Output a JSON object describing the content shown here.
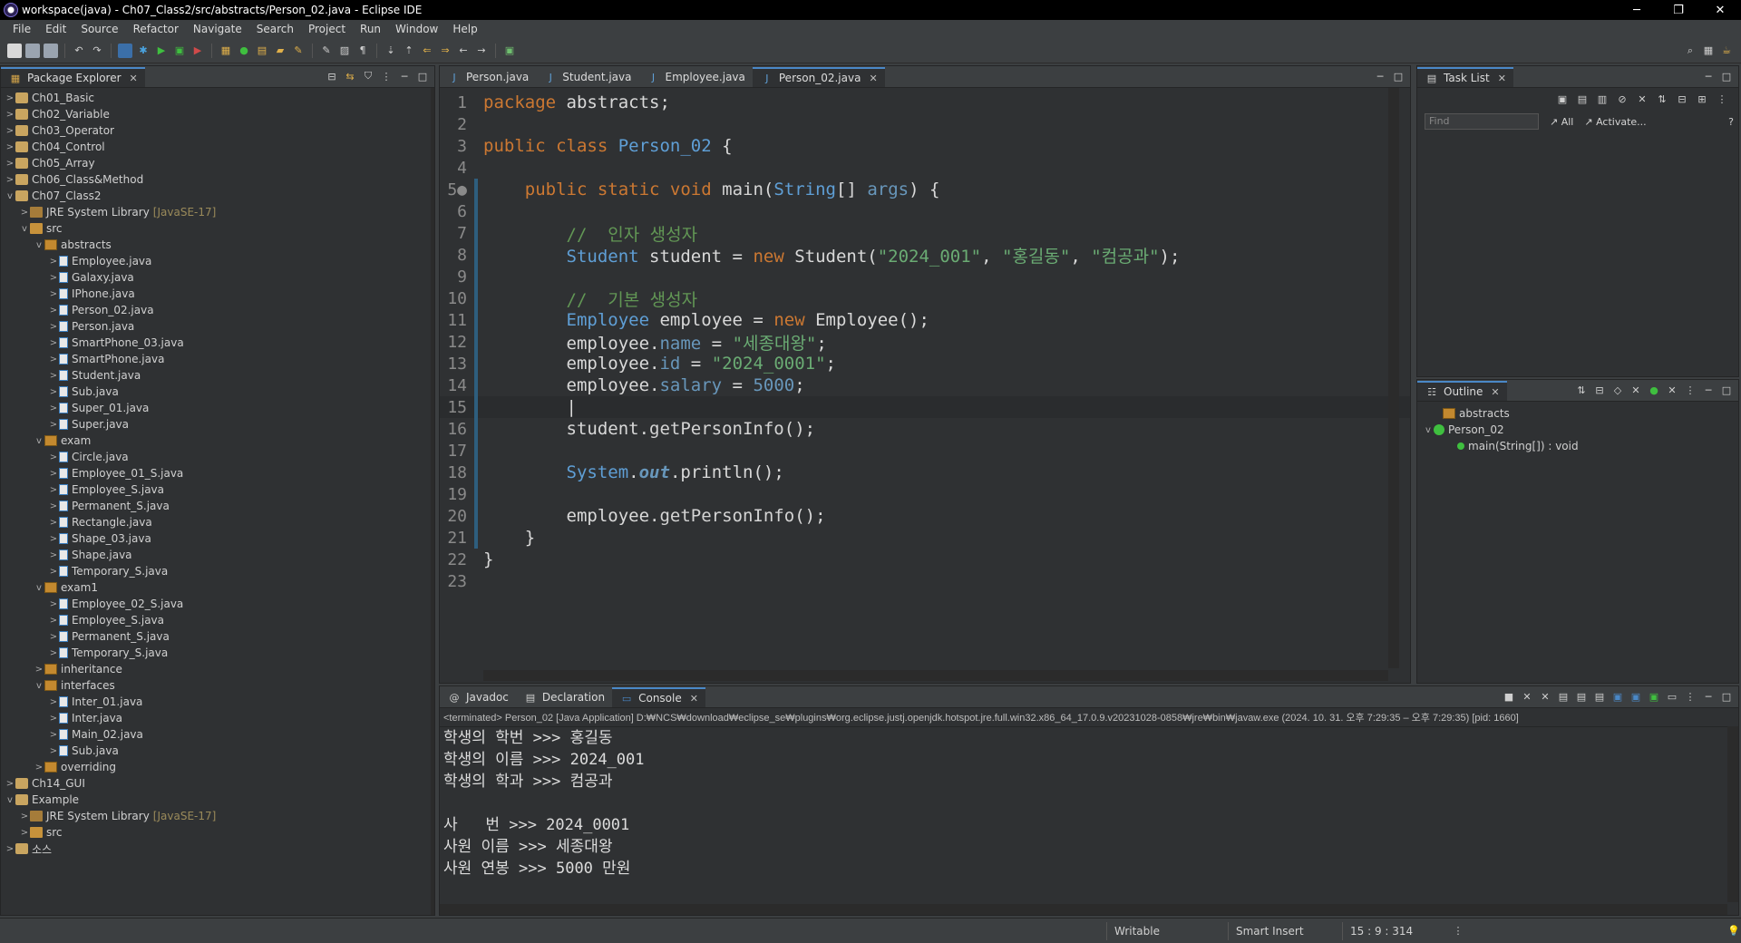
{
  "window": {
    "title": "workspace(java) - Ch07_Class2/src/abstracts/Person_02.java - Eclipse IDE"
  },
  "menu": [
    "File",
    "Edit",
    "Source",
    "Refactor",
    "Navigate",
    "Search",
    "Project",
    "Run",
    "Window",
    "Help"
  ],
  "package_explorer": {
    "title": "Package Explorer",
    "items": [
      {
        "depth": 0,
        "arrow": ">",
        "icon": "project",
        "label": "Ch01_Basic"
      },
      {
        "depth": 0,
        "arrow": ">",
        "icon": "project",
        "label": "Ch02_Variable"
      },
      {
        "depth": 0,
        "arrow": ">",
        "icon": "project",
        "label": "Ch03_Operator"
      },
      {
        "depth": 0,
        "arrow": ">",
        "icon": "project",
        "label": "Ch04_Control"
      },
      {
        "depth": 0,
        "arrow": ">",
        "icon": "project",
        "label": "Ch05_Array"
      },
      {
        "depth": 0,
        "arrow": ">",
        "icon": "project",
        "label": "Ch06_Class&Method"
      },
      {
        "depth": 0,
        "arrow": "v",
        "icon": "project",
        "label": "Ch07_Class2"
      },
      {
        "depth": 1,
        "arrow": ">",
        "icon": "lib",
        "label": "JRE System Library",
        "extra": "[JavaSE-17]"
      },
      {
        "depth": 1,
        "arrow": "v",
        "icon": "src",
        "label": "src"
      },
      {
        "depth": 2,
        "arrow": "v",
        "icon": "pkg",
        "label": "abstracts"
      },
      {
        "depth": 3,
        "arrow": ">",
        "icon": "java",
        "label": "Employee.java"
      },
      {
        "depth": 3,
        "arrow": ">",
        "icon": "java",
        "label": "Galaxy.java"
      },
      {
        "depth": 3,
        "arrow": ">",
        "icon": "java",
        "label": "IPhone.java"
      },
      {
        "depth": 3,
        "arrow": ">",
        "icon": "java",
        "label": "Person_02.java"
      },
      {
        "depth": 3,
        "arrow": ">",
        "icon": "java",
        "label": "Person.java"
      },
      {
        "depth": 3,
        "arrow": ">",
        "icon": "java",
        "label": "SmartPhone_03.java"
      },
      {
        "depth": 3,
        "arrow": ">",
        "icon": "java",
        "label": "SmartPhone.java"
      },
      {
        "depth": 3,
        "arrow": ">",
        "icon": "java",
        "label": "Student.java"
      },
      {
        "depth": 3,
        "arrow": ">",
        "icon": "java",
        "label": "Sub.java"
      },
      {
        "depth": 3,
        "arrow": ">",
        "icon": "java",
        "label": "Super_01.java"
      },
      {
        "depth": 3,
        "arrow": ">",
        "icon": "java",
        "label": "Super.java"
      },
      {
        "depth": 2,
        "arrow": "v",
        "icon": "pkg",
        "label": "exam"
      },
      {
        "depth": 3,
        "arrow": ">",
        "icon": "java",
        "label": "Circle.java"
      },
      {
        "depth": 3,
        "arrow": ">",
        "icon": "java",
        "label": "Employee_01_S.java"
      },
      {
        "depth": 3,
        "arrow": ">",
        "icon": "java",
        "label": "Employee_S.java"
      },
      {
        "depth": 3,
        "arrow": ">",
        "icon": "java",
        "label": "Permanent_S.java"
      },
      {
        "depth": 3,
        "arrow": ">",
        "icon": "java",
        "label": "Rectangle.java"
      },
      {
        "depth": 3,
        "arrow": ">",
        "icon": "java",
        "label": "Shape_03.java"
      },
      {
        "depth": 3,
        "arrow": ">",
        "icon": "java",
        "label": "Shape.java"
      },
      {
        "depth": 3,
        "arrow": ">",
        "icon": "java",
        "label": "Temporary_S.java"
      },
      {
        "depth": 2,
        "arrow": "v",
        "icon": "pkg",
        "label": "exam1"
      },
      {
        "depth": 3,
        "arrow": ">",
        "icon": "java",
        "label": "Employee_02_S.java"
      },
      {
        "depth": 3,
        "arrow": ">",
        "icon": "java",
        "label": "Employee_S.java"
      },
      {
        "depth": 3,
        "arrow": ">",
        "icon": "java",
        "label": "Permanent_S.java"
      },
      {
        "depth": 3,
        "arrow": ">",
        "icon": "java",
        "label": "Temporary_S.java"
      },
      {
        "depth": 2,
        "arrow": ">",
        "icon": "pkg",
        "label": "inheritance"
      },
      {
        "depth": 2,
        "arrow": "v",
        "icon": "pkg",
        "label": "interfaces"
      },
      {
        "depth": 3,
        "arrow": ">",
        "icon": "java",
        "label": "Inter_01.java"
      },
      {
        "depth": 3,
        "arrow": ">",
        "icon": "java",
        "label": "Inter.java"
      },
      {
        "depth": 3,
        "arrow": ">",
        "icon": "java",
        "label": "Main_02.java"
      },
      {
        "depth": 3,
        "arrow": ">",
        "icon": "java",
        "label": "Sub.java"
      },
      {
        "depth": 2,
        "arrow": ">",
        "icon": "pkg",
        "label": "overriding"
      },
      {
        "depth": 0,
        "arrow": ">",
        "icon": "project",
        "label": "Ch14_GUI"
      },
      {
        "depth": 0,
        "arrow": "v",
        "icon": "project",
        "label": "Example"
      },
      {
        "depth": 1,
        "arrow": ">",
        "icon": "lib",
        "label": "JRE System Library",
        "extra": "[JavaSE-17]"
      },
      {
        "depth": 1,
        "arrow": ">",
        "icon": "src",
        "label": "src"
      },
      {
        "depth": 0,
        "arrow": ">",
        "icon": "project",
        "label": "소스"
      }
    ]
  },
  "editor": {
    "tabs": [
      {
        "label": "Person.java",
        "active": false
      },
      {
        "label": "Student.java",
        "active": false
      },
      {
        "label": "Employee.java",
        "active": false
      },
      {
        "label": "Person_02.java",
        "active": true
      }
    ],
    "lines": [
      {
        "n": "1",
        "html": "<span class='kw'>package</span> abstracts;"
      },
      {
        "n": "2",
        "html": ""
      },
      {
        "n": "3",
        "html": "<span class='kw'>public class</span> <span class='ty'>Person_02</span> {"
      },
      {
        "n": "4",
        "html": ""
      },
      {
        "n": "5●",
        "html": "    <span class='kw'>public static void</span> <span class='fn'>main</span>(<span class='ty'>String</span>[] <span class='fld'>args</span>) {"
      },
      {
        "n": "6",
        "html": ""
      },
      {
        "n": "7",
        "html": "        <span class='cm'>//  인자 생성자</span>"
      },
      {
        "n": "8",
        "html": "        <span class='ty'>Student</span> student = <span class='kw'>new</span> Student(<span class='str'>\"2024_001\"</span>, <span class='str'>\"홍길동\"</span>, <span class='str'>\"컴공과\"</span>);"
      },
      {
        "n": "9",
        "html": ""
      },
      {
        "n": "10",
        "html": "        <span class='cm'>//  기본 생성자</span>"
      },
      {
        "n": "11",
        "html": "        <span class='ty'>Employee</span> employee = <span class='kw'>new</span> Employee();"
      },
      {
        "n": "12",
        "html": "        employee.<span class='fld'>name</span> = <span class='str'>\"세종대왕\"</span>;"
      },
      {
        "n": "13",
        "html": "        employee.<span class='fld'>id</span> = <span class='str'>\"2024_0001\"</span>;"
      },
      {
        "n": "14",
        "html": "        employee.<span class='fld'>salary</span> = <span class='fld'>5000</span>;"
      },
      {
        "n": "15",
        "html": "        |"
      },
      {
        "n": "16",
        "html": "        student.<span class='fn'>getPersonInfo</span>();"
      },
      {
        "n": "17",
        "html": ""
      },
      {
        "n": "18",
        "html": "        <span class='ty'>System</span>.<span class='fld'><i><b>out</b></i></span>.println();"
      },
      {
        "n": "19",
        "html": ""
      },
      {
        "n": "20",
        "html": "        employee.<span class='fn'>getPersonInfo</span>();"
      },
      {
        "n": "21",
        "html": "    }"
      },
      {
        "n": "22",
        "html": "}"
      },
      {
        "n": "23",
        "html": ""
      }
    ]
  },
  "task_list": {
    "title": "Task List",
    "find_placeholder": "Find",
    "all": "All",
    "activate": "Activate..."
  },
  "outline": {
    "title": "Outline",
    "items": [
      {
        "depth": 0,
        "label": "abstracts"
      },
      {
        "depth": 0,
        "label": "Person_02"
      },
      {
        "depth": 1,
        "label": "main(String[]) : void"
      }
    ]
  },
  "console": {
    "tabs": [
      {
        "label": "Javadoc",
        "active": false
      },
      {
        "label": "Declaration",
        "active": false
      },
      {
        "label": "Console",
        "active": true
      }
    ],
    "header": "<terminated> Person_02 [Java Application] D:₩NCS₩download₩eclipse_se₩plugins₩org.eclipse.justj.openjdk.hotspot.jre.full.win32.x86_64_17.0.9.v20231028-0858₩jre₩bin₩javaw.exe  (2024. 10. 31. 오후 7:29:35 – 오후 7:29:35) [pid: 1660]",
    "lines": [
      "학생의 학번 >>> 홍길동",
      "학생의 이름 >>> 2024_001",
      "학생의 학과 >>> 컴공과",
      "",
      "사   번 >>> 2024_0001",
      "사원 이름 >>> 세종대왕",
      "사원 연봉 >>> 5000 만원"
    ]
  },
  "statusbar": {
    "writable": "Writable",
    "insert": "Smart Insert",
    "position": "15 : 9 : 314"
  }
}
